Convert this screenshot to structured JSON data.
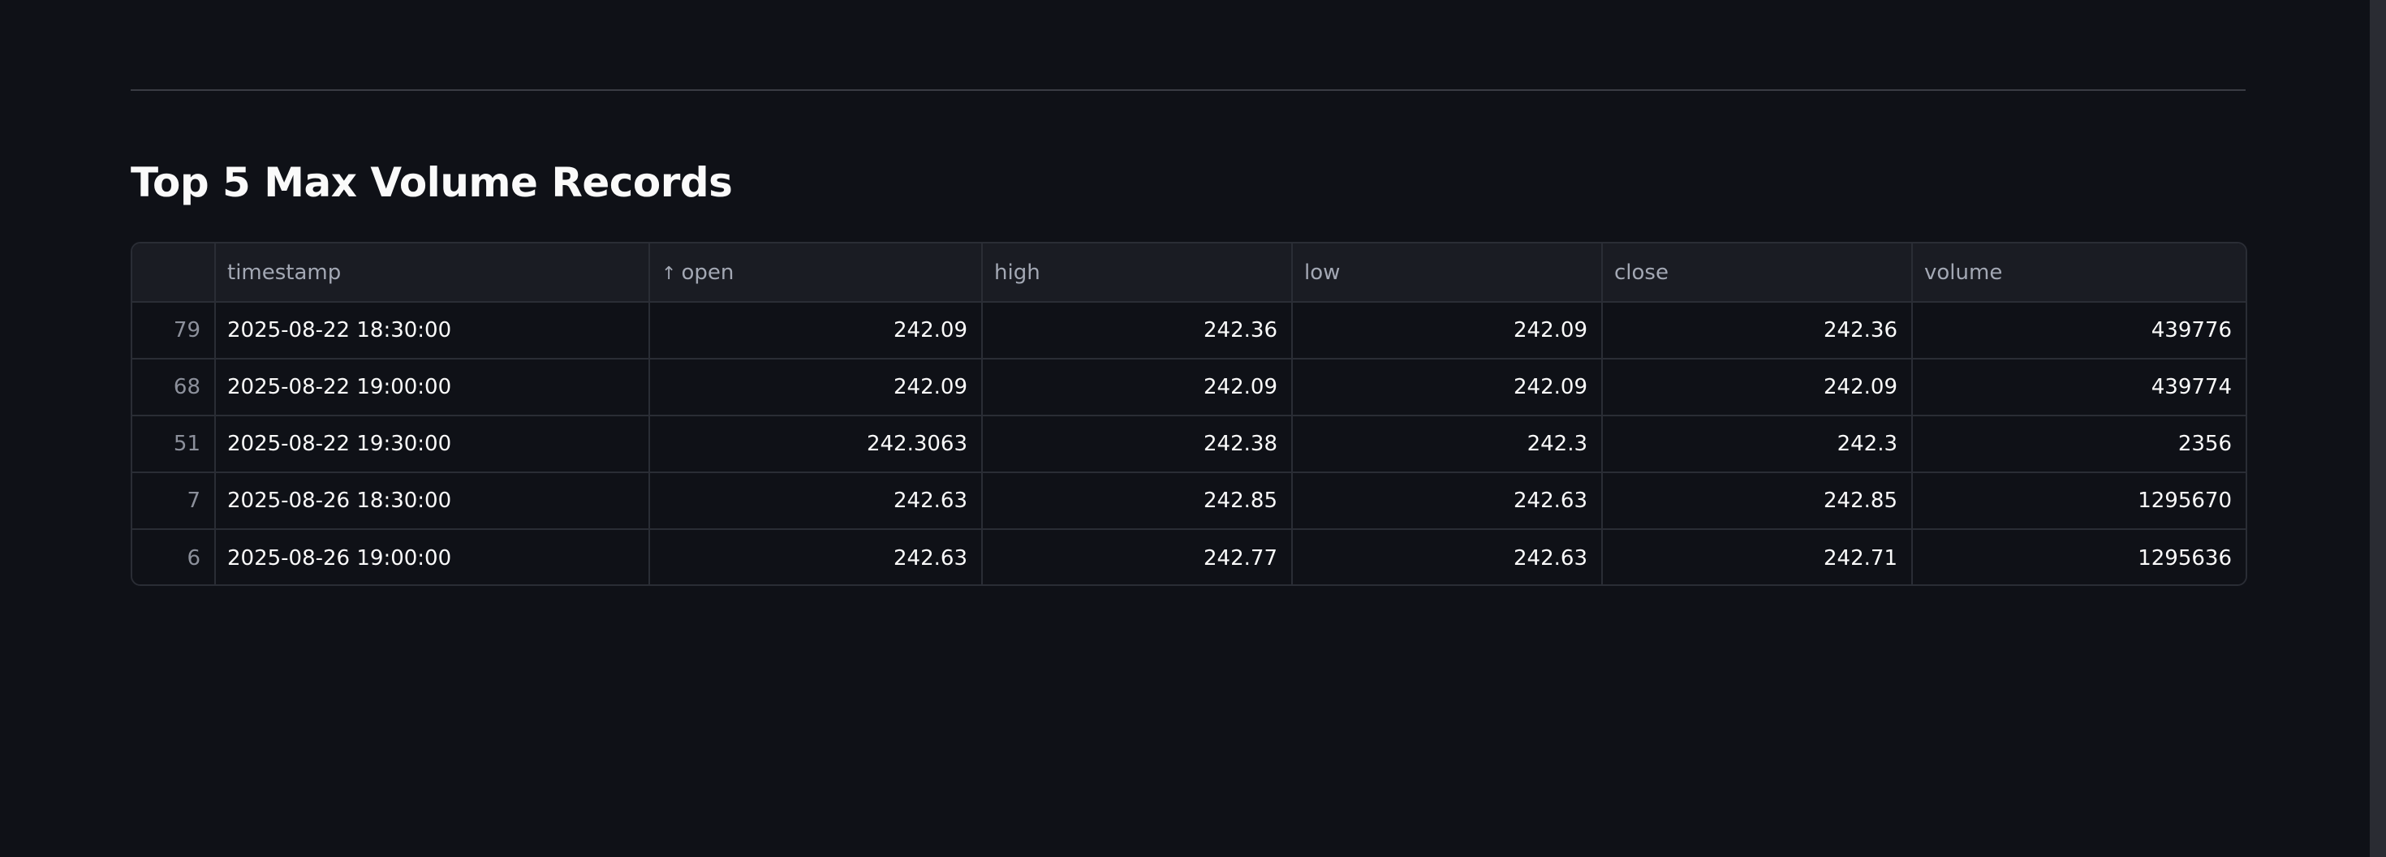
{
  "title": "Top 5 Max Volume Records",
  "table": {
    "columns": [
      "",
      "timestamp",
      "open",
      "high",
      "low",
      "close",
      "volume"
    ],
    "sorted_column": "open",
    "sort_direction": "ascending",
    "rows": [
      {
        "index": "79",
        "timestamp": "2025-08-22 18:30:00",
        "open": "242.09",
        "high": "242.36",
        "low": "242.09",
        "close": "242.36",
        "volume": "439776"
      },
      {
        "index": "68",
        "timestamp": "2025-08-22 19:00:00",
        "open": "242.09",
        "high": "242.09",
        "low": "242.09",
        "close": "242.09",
        "volume": "439774"
      },
      {
        "index": "51",
        "timestamp": "2025-08-22 19:30:00",
        "open": "242.3063",
        "high": "242.38",
        "low": "242.3",
        "close": "242.3",
        "volume": "2356"
      },
      {
        "index": "7",
        "timestamp": "2025-08-26 18:30:00",
        "open": "242.63",
        "high": "242.85",
        "low": "242.63",
        "close": "242.85",
        "volume": "1295670"
      },
      {
        "index": "6",
        "timestamp": "2025-08-26 19:00:00",
        "open": "242.63",
        "high": "242.77",
        "low": "242.63",
        "close": "242.71",
        "volume": "1295636"
      }
    ]
  },
  "colors": {
    "background": "#0f1117",
    "header_background": "#1a1c23",
    "border": "#2a2d35",
    "text": "#fafafa",
    "muted_text": "#a3a8b4"
  },
  "icons": {
    "sort": "arrow-up-icon"
  }
}
